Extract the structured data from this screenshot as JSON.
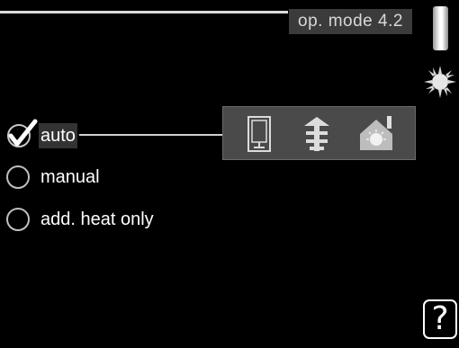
{
  "header": {
    "title": "op. mode 4.2"
  },
  "options": [
    {
      "label": "auto",
      "selected": true
    },
    {
      "label": "manual",
      "selected": false
    },
    {
      "label": "add. heat only",
      "selected": false
    }
  ],
  "icons": {
    "season": "sun-icon",
    "heat_sources": [
      "compressor-icon",
      "additional-heat-icon",
      "heating-icon"
    ],
    "help": "?"
  },
  "colors": {
    "background": "#000000",
    "panel": "#4a4a4a",
    "title_badge": "#3b3b3b"
  }
}
